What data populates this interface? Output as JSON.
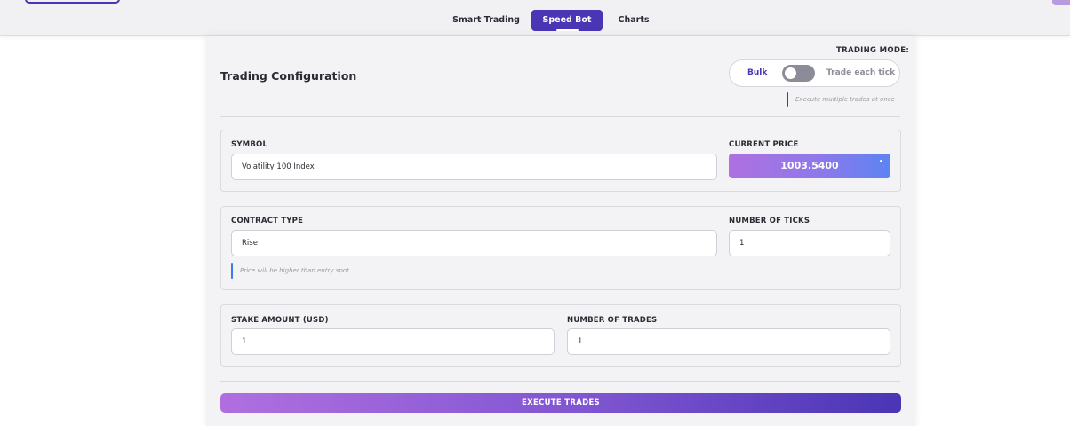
{
  "nav": {
    "tabs": [
      {
        "label": "Smart Trading",
        "active": false
      },
      {
        "label": "Speed Bot",
        "active": true
      },
      {
        "label": "Charts",
        "active": false
      }
    ]
  },
  "config": {
    "title": "Trading Configuration",
    "mode": {
      "label": "TRADING MODE:",
      "option_bulk": "Bulk",
      "option_each": "Trade each tick",
      "selected": "Bulk",
      "hint": "Execute multiple trades at once"
    },
    "symbol": {
      "label": "SYMBOL",
      "value": "Volatility 100 Index"
    },
    "price": {
      "label": "CURRENT PRICE",
      "value": "1003.5400"
    },
    "contract": {
      "label": "CONTRACT TYPE",
      "value": "Rise",
      "hint": "Price will be higher than entry spot"
    },
    "ticks": {
      "label": "NUMBER OF TICKS",
      "value": "1"
    },
    "stake": {
      "label": "STAKE AMOUNT (USD)",
      "value": "1"
    },
    "trades": {
      "label": "NUMBER OF TRADES",
      "value": "1"
    },
    "execute_label": "EXECUTE TRADES"
  },
  "colors": {
    "accent": "#4a35b5",
    "price_gradient_start": "#b070e0",
    "price_gradient_end": "#5d84f2",
    "hint_blue": "#3b7af0"
  }
}
